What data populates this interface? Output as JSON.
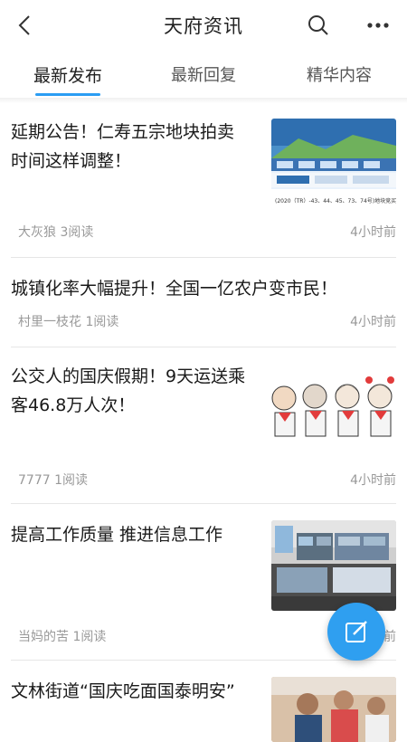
{
  "header": {
    "title": "天府资讯",
    "back_icon": "chevron-left-icon",
    "search_icon": "search-icon",
    "more_icon": "more-horizontal-icon"
  },
  "tabs": [
    {
      "label": "最新发布",
      "active": true
    },
    {
      "label": "最新回复",
      "active": false
    },
    {
      "label": "精华内容",
      "active": false
    }
  ],
  "colors": {
    "accent": "#2b9df3"
  },
  "articles": [
    {
      "title_line1": "延期公告！仁寿五宗地块拍卖",
      "title_line2": "时间这样调整！",
      "author_reads": "大灰狼 3阅读",
      "time": "4小时前",
      "thumb_text": "(2020（TR）-43、44、45、73、74号)地块竞买公告"
    },
    {
      "title": "城镇化率大幅提升！全国一亿农户变市民！",
      "author_reads": "村里一枝花 1阅读",
      "time": "4小时前"
    },
    {
      "title_line1": "公交人的国庆假期！9天运送乘",
      "title_line2": "客46.8万人次！",
      "author_reads": "7777 1阅读",
      "time": "4小时前"
    },
    {
      "title": "提高工作质量 推进信息工作",
      "author_reads": "当妈的苦 1阅读",
      "time": "4小时前"
    },
    {
      "title": "文林街道“国庆吃面国泰明安”"
    }
  ],
  "fab_icon": "compose-icon"
}
